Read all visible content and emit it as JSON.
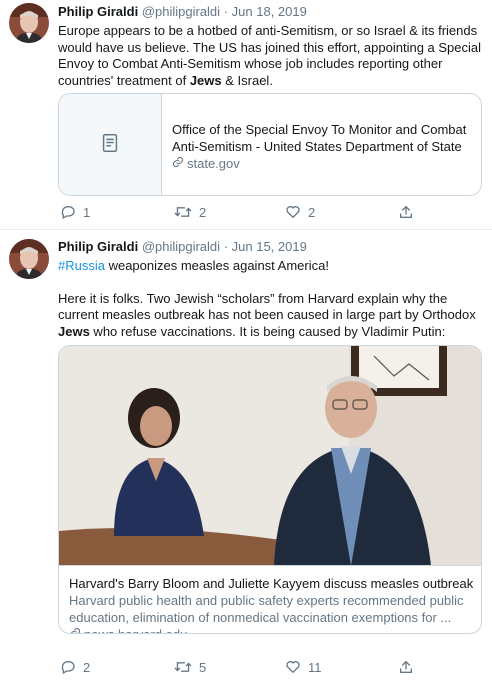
{
  "tweets": [
    {
      "author": "Philip Giraldi",
      "handle": "@philipgiraldi",
      "separator": "·",
      "date": "Jun 18, 2019",
      "text_part1": "Europe appears to be a hotbed of anti-Semitism, or so Israel & its friends would have us believe. The US has joined this effort, appointing a Special Envoy to Combat Anti-Semitism whose job includes reporting other countries' treatment of ",
      "text_bold": "Jews",
      "text_part2": " & Israel.",
      "card": {
        "title": "Office of the Special Envoy To Monitor and Combat Anti-Semitism - United States Department of State",
        "domain": "state.gov",
        "thumb_icon": "document-icon"
      },
      "actions": {
        "replies": "1",
        "retweets": "2",
        "likes": "2"
      }
    },
    {
      "author": "Philip Giraldi",
      "handle": "@philipgiraldi",
      "separator": "·",
      "date": "Jun 15, 2019",
      "hashtag": "#Russia",
      "text_line1": " weaponizes measles against America!",
      "text_part1": "Here it is folks. Two Jewish “scholars” from Harvard explain why the current measles outbreak has not been caused in large part by Orthodox ",
      "text_bold": "Jews",
      "text_part2": " who refuse vaccinations. It is being caused by Vladimir Putin:",
      "card": {
        "title": "Harvard's Barry Bloom and Juliette Kayyem discuss measles outbreak",
        "description": "Harvard public health and public safety experts recommended public education, elimination of nonmedical vaccination exemptions for ...",
        "domain": "news.harvard.edu"
      },
      "actions": {
        "replies": "2",
        "retweets": "5",
        "likes": "11"
      }
    }
  ],
  "colors": {
    "link": "#1b95e0",
    "muted": "#657786",
    "text": "#14171a",
    "border": "#ccd6dd"
  }
}
